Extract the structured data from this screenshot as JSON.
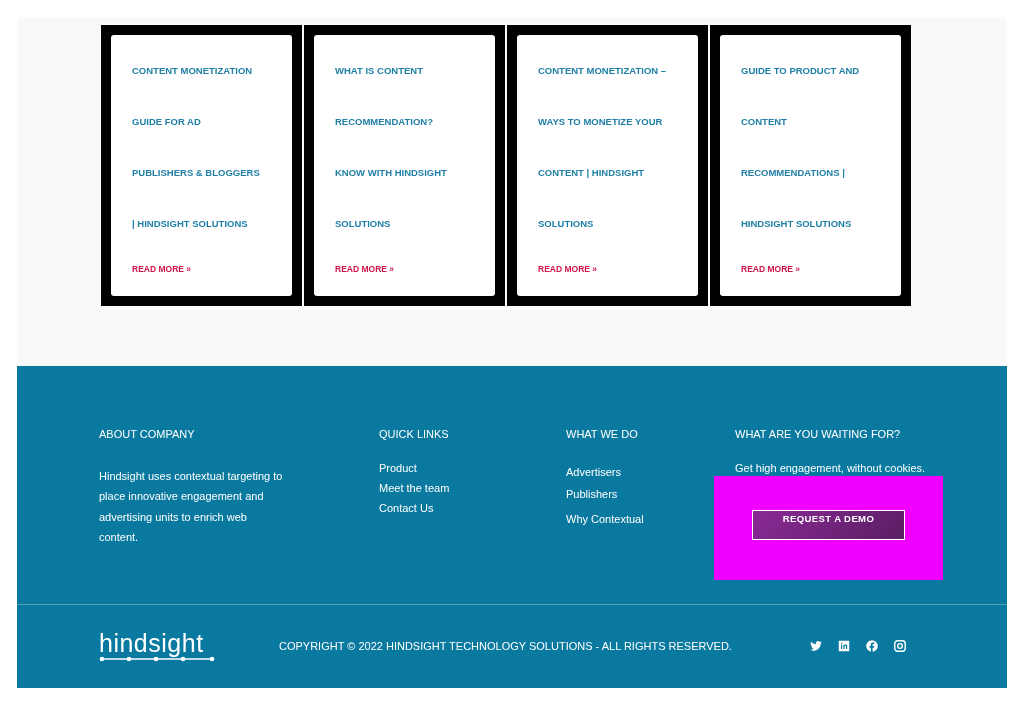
{
  "posts": [
    {
      "title_lines": [
        "CONTENT MONETIZATION",
        "GUIDE FOR AD",
        "PUBLISHERS & BLOGGERS",
        "| HINDSIGHT SOLUTIONS"
      ],
      "link": "READ MORE »"
    },
    {
      "title_lines": [
        "WHAT IS CONTENT",
        "RECOMMENDATION?",
        "KNOW WITH HINDSIGHT",
        "SOLUTIONS"
      ],
      "link": "READ MORE »"
    },
    {
      "title_lines": [
        "CONTENT MONETIZATION –",
        "WAYS TO MONETIZE YOUR",
        "CONTENT | HINDSIGHT",
        "SOLUTIONS"
      ],
      "link": "READ MORE »"
    },
    {
      "title_lines": [
        "GUIDE TO PRODUCT AND",
        "CONTENT",
        "RECOMMENDATIONS |",
        "HINDSIGHT SOLUTIONS"
      ],
      "link": "READ MORE »"
    }
  ],
  "footer": {
    "about": {
      "heading": "ABOUT COMPANY",
      "text": "Hindsight uses contextual targeting to place innovative engagement and advertising units to enrich web content."
    },
    "quick_links": {
      "heading": "QUICK LINKS",
      "links": [
        "Product",
        "Meet the team",
        "Contact Us"
      ]
    },
    "what_we_do": {
      "heading": "WHAT WE DO",
      "links": [
        "Advertisers",
        "Publishers",
        "Why Contextual"
      ]
    },
    "cta": {
      "heading": "WHAT ARE YOU WAITING FOR?",
      "text": "Get high engagement, without cookies.",
      "button": "REQUEST A DEMO"
    },
    "logo": "hindsight",
    "copyright": "COPYRIGHT © 2022 HINDSIGHT TECHNOLOGY SOLUTIONS - ALL RIGHTS RESERVED.",
    "social": [
      {
        "kind": "twitter"
      },
      {
        "kind": "linkedin"
      },
      {
        "kind": "facebook"
      },
      {
        "kind": "instagram"
      }
    ]
  }
}
